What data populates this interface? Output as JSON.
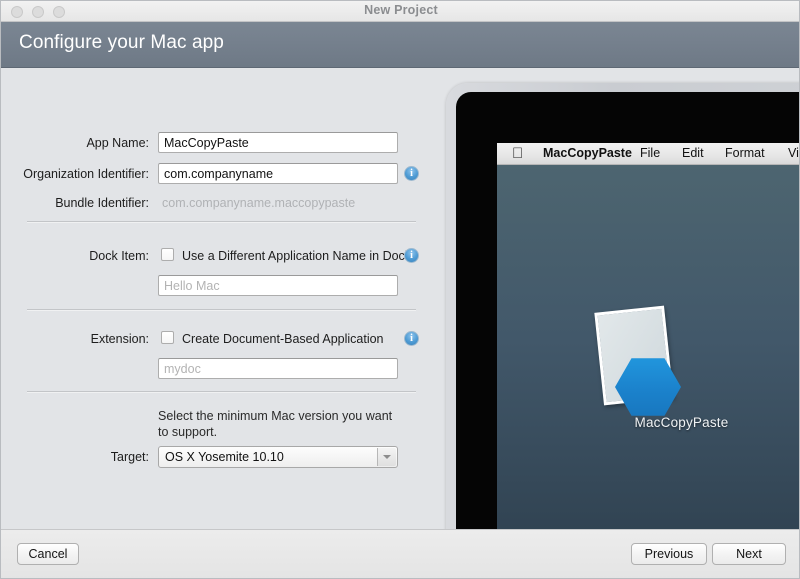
{
  "window": {
    "title": "New Project",
    "traffic_lights": [
      "close",
      "minimize",
      "maximize"
    ]
  },
  "header": {
    "title": "Configure your Mac app",
    "background": "#6e7986"
  },
  "form": {
    "app_name": {
      "label": "App Name:",
      "value": "MacCopyPaste",
      "placeholder": ""
    },
    "organization_identifier": {
      "label": "Organization Identifier:",
      "value": "com.companyname",
      "placeholder": "",
      "info": "i"
    },
    "bundle_identifier": {
      "label": "Bundle Identifier:",
      "value": "com.companyname.maccopypaste"
    },
    "dock_item": {
      "label": "Dock Item:",
      "checkbox_label": "Use a Different Application Name in Dock",
      "checked": false,
      "input_value": "",
      "input_placeholder": "Hello Mac",
      "info": "i"
    },
    "extension": {
      "label": "Extension:",
      "checkbox_label": "Create Document-Based Application",
      "checked": false,
      "input_value": "",
      "input_placeholder": "mydoc",
      "info": "i"
    },
    "target": {
      "help_text": "Select the minimum Mac version you want to support.",
      "label": "Target:",
      "selected": "OS X Yosemite 10.10",
      "options": [
        "OS X Yosemite 10.10"
      ]
    }
  },
  "preview": {
    "menubar": {
      "apple_glyph": "",
      "items": [
        "MacCopyPaste",
        "File",
        "Edit",
        "Format",
        "View"
      ]
    },
    "app_icon_label": "MacCopyPaste",
    "desktop_color_top": "#4d6570",
    "desktop_color_bottom": "#2f4150",
    "hexagon_color": "#1b82cc"
  },
  "footer": {
    "cancel_label": "Cancel",
    "previous_label": "Previous",
    "next_label": "Next"
  }
}
